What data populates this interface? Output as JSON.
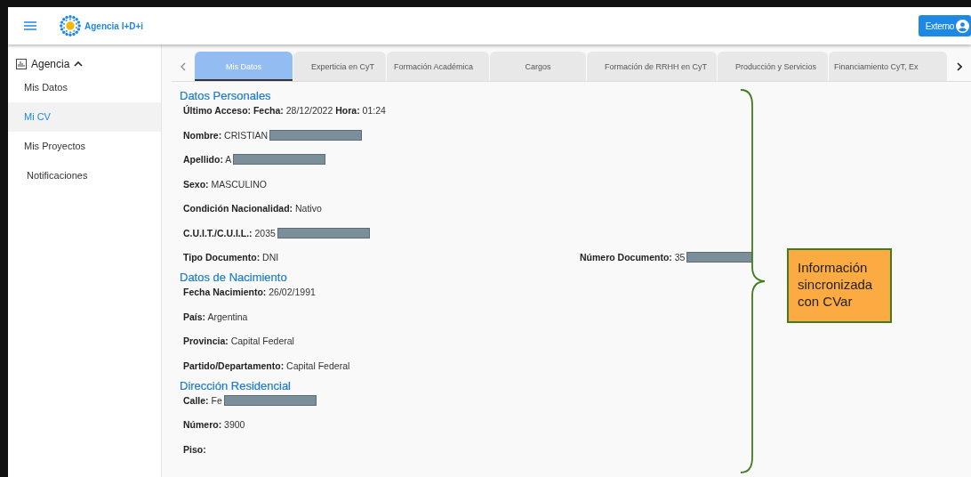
{
  "header": {
    "logo_text": "Agencia I+D+i",
    "user_button": "Externo"
  },
  "sidebar": {
    "group": {
      "label": "Agencia",
      "expanded": true
    },
    "items": [
      {
        "label": "Mis Datos",
        "selected": false
      },
      {
        "label": "Mi CV",
        "selected": true
      },
      {
        "label": "Mis Proyectos",
        "selected": false
      },
      {
        "label": "Notificaciones",
        "selected": false
      }
    ]
  },
  "tabs": [
    {
      "label": "Mis Datos",
      "selected": true
    },
    {
      "label": "Experticia en CyT",
      "selected": false
    },
    {
      "label": "Formación Académica",
      "selected": false
    },
    {
      "label": "Cargos",
      "selected": false
    },
    {
      "label": "Formación de RRHH en CyT",
      "selected": false
    },
    {
      "label": "Producción y Servicios",
      "selected": false
    },
    {
      "label": "Financiamiento CyT, Ex",
      "selected": false
    }
  ],
  "sections": [
    {
      "title": "Datos Personales",
      "rows": [
        {
          "label": "Último Acceso: Fecha:",
          "value": "28/12/2022 **Hora:** 01:24",
          "redacted": false
        },
        {
          "label": "Nombre:",
          "value": "CRISTIAN",
          "redacted": true
        },
        {
          "label": "Apellido:",
          "value": "A",
          "redacted": true
        },
        {
          "label": "Sexo:",
          "value": "MASCULINO",
          "redacted": false
        },
        {
          "label": "Condición Nacionalidad:",
          "value": "Nativo",
          "redacted": false
        },
        {
          "label": "C.U.I.T./C.U.I.L.:",
          "value": "2035",
          "redacted": true
        },
        {
          "label": "Tipo Documento:",
          "value": "DNI",
          "redacted": false,
          "right": {
            "label": "Número Documento:",
            "value": "35",
            "redacted": true
          }
        }
      ]
    },
    {
      "title": "Datos de Nacimiento",
      "rows": [
        {
          "label": "Fecha Nacimiento:",
          "value": "26/02/1991",
          "redacted": false
        },
        {
          "label": "País:",
          "value": "Argentina",
          "redacted": false
        },
        {
          "label": "Provincia:",
          "value": "Capital Federal",
          "redacted": false
        },
        {
          "label": "Partido/Departamento:",
          "value": "Capital Federal",
          "redacted": false
        }
      ]
    },
    {
      "title": "Dirección Residencial",
      "rows": [
        {
          "label": "Calle:",
          "value": "Fe",
          "redacted": true
        },
        {
          "label": "Número:",
          "value": "3900",
          "redacted": false
        },
        {
          "label": "Piso:",
          "value": "",
          "redacted": false
        }
      ]
    }
  ],
  "annotation": {
    "text": "Información sincronizada con CVar"
  }
}
